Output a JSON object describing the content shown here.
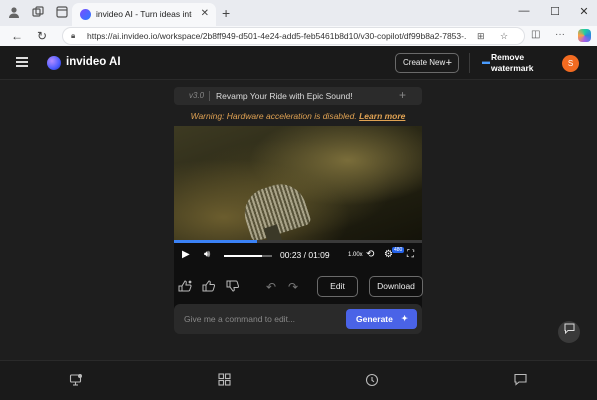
{
  "browser": {
    "tab_title": "invideo AI - Turn ideas into video",
    "url": "https://ai.invideo.io/workspace/2b8ff949-d501-4e24-add5-feb5461b8d10/v30-copilot/df99b8a2-7853-..."
  },
  "header": {
    "app_name": "invideo AI",
    "create_new": "Create New",
    "remove_watermark_line1": "Remove",
    "remove_watermark_line2": "watermark",
    "avatar_initial": "S"
  },
  "version_bar": {
    "version": "v3.0",
    "title": "Revamp Your Ride with Epic Sound!"
  },
  "warning": {
    "text": "Warning: Hardware acceleration is disabled.",
    "link": "Learn more"
  },
  "player": {
    "current_time": "00:23",
    "total_time": "01:09",
    "time_display": "00:23 / 01:09",
    "speed": "1.00x",
    "quality": "480",
    "progress": 0.333,
    "volume": 0.8
  },
  "actions": {
    "edit_label": "Edit",
    "download_label": "Download"
  },
  "command": {
    "placeholder": "Give me a command to edit...",
    "generate_label": "Generate"
  },
  "colors": {
    "accent": "#4a63e7",
    "warning": "#e0a253",
    "avatar": "#f26b21",
    "progress": "#3b82f6"
  }
}
